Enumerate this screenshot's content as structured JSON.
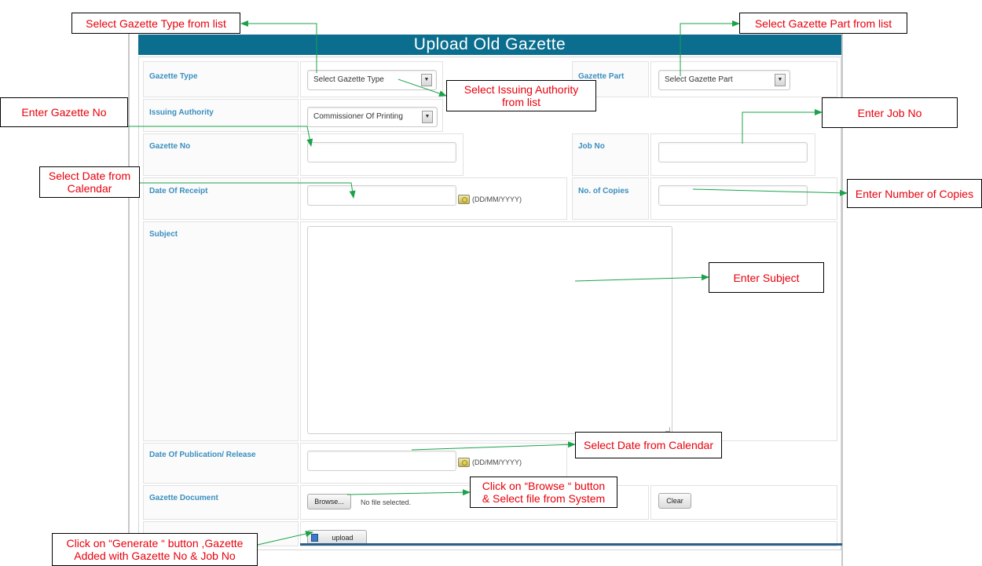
{
  "window": {
    "title": "Upload Old Gazette"
  },
  "form": {
    "gazette_type": {
      "label": "Gazette Type",
      "selected": "Select Gazette Type"
    },
    "gazette_part": {
      "label": "Gazette Part",
      "selected": "Select Gazette Part"
    },
    "issuing_authority": {
      "label": "Issuing Authority",
      "selected": "Commissioner Of Printing"
    },
    "gazette_no": {
      "label": "Gazette No",
      "value": ""
    },
    "job_no": {
      "label": "Job No",
      "value": ""
    },
    "date_of_receipt": {
      "label": "Date Of Receipt",
      "value": "",
      "format_hint": "(DD/MM/YYYY)"
    },
    "no_of_copies": {
      "label": "No. of Copies",
      "value": ""
    },
    "subject": {
      "label": "Subject",
      "value": ""
    },
    "date_of_publication": {
      "label": "Date Of Publication/ Release",
      "value": "",
      "format_hint": "(DD/MM/YYYY)"
    },
    "gazette_document": {
      "label": "Gazette Document",
      "browse_label": "Browse...",
      "file_status": "No file selected.",
      "clear_label": "Clear"
    },
    "upload_label": "upload"
  },
  "callouts": {
    "select_gazette_type": "Select Gazette Type from list",
    "select_gazette_part": "Select Gazette Part from list",
    "select_issuing_authority": "Select Issuing Authority\nfrom list",
    "enter_gazette_no": "Enter Gazette No",
    "enter_job_no": "Enter Job No",
    "select_date_receipt": "Select Date from\nCalendar",
    "enter_copies": "Enter Number of Copies",
    "enter_subject": "Enter Subject",
    "select_date_publication": "Select Date from Calendar",
    "browse_file": "Click on “Browse “ button\n& Select file from System",
    "generate": "Click on “Generate “ button ,Gazette\nAdded with Gazette No & Job No"
  },
  "colors": {
    "title_bar": "#0b6e8e",
    "label_text": "#3a8fc0",
    "callout_text": "#e8000b",
    "arrow": "#1aa34a"
  }
}
